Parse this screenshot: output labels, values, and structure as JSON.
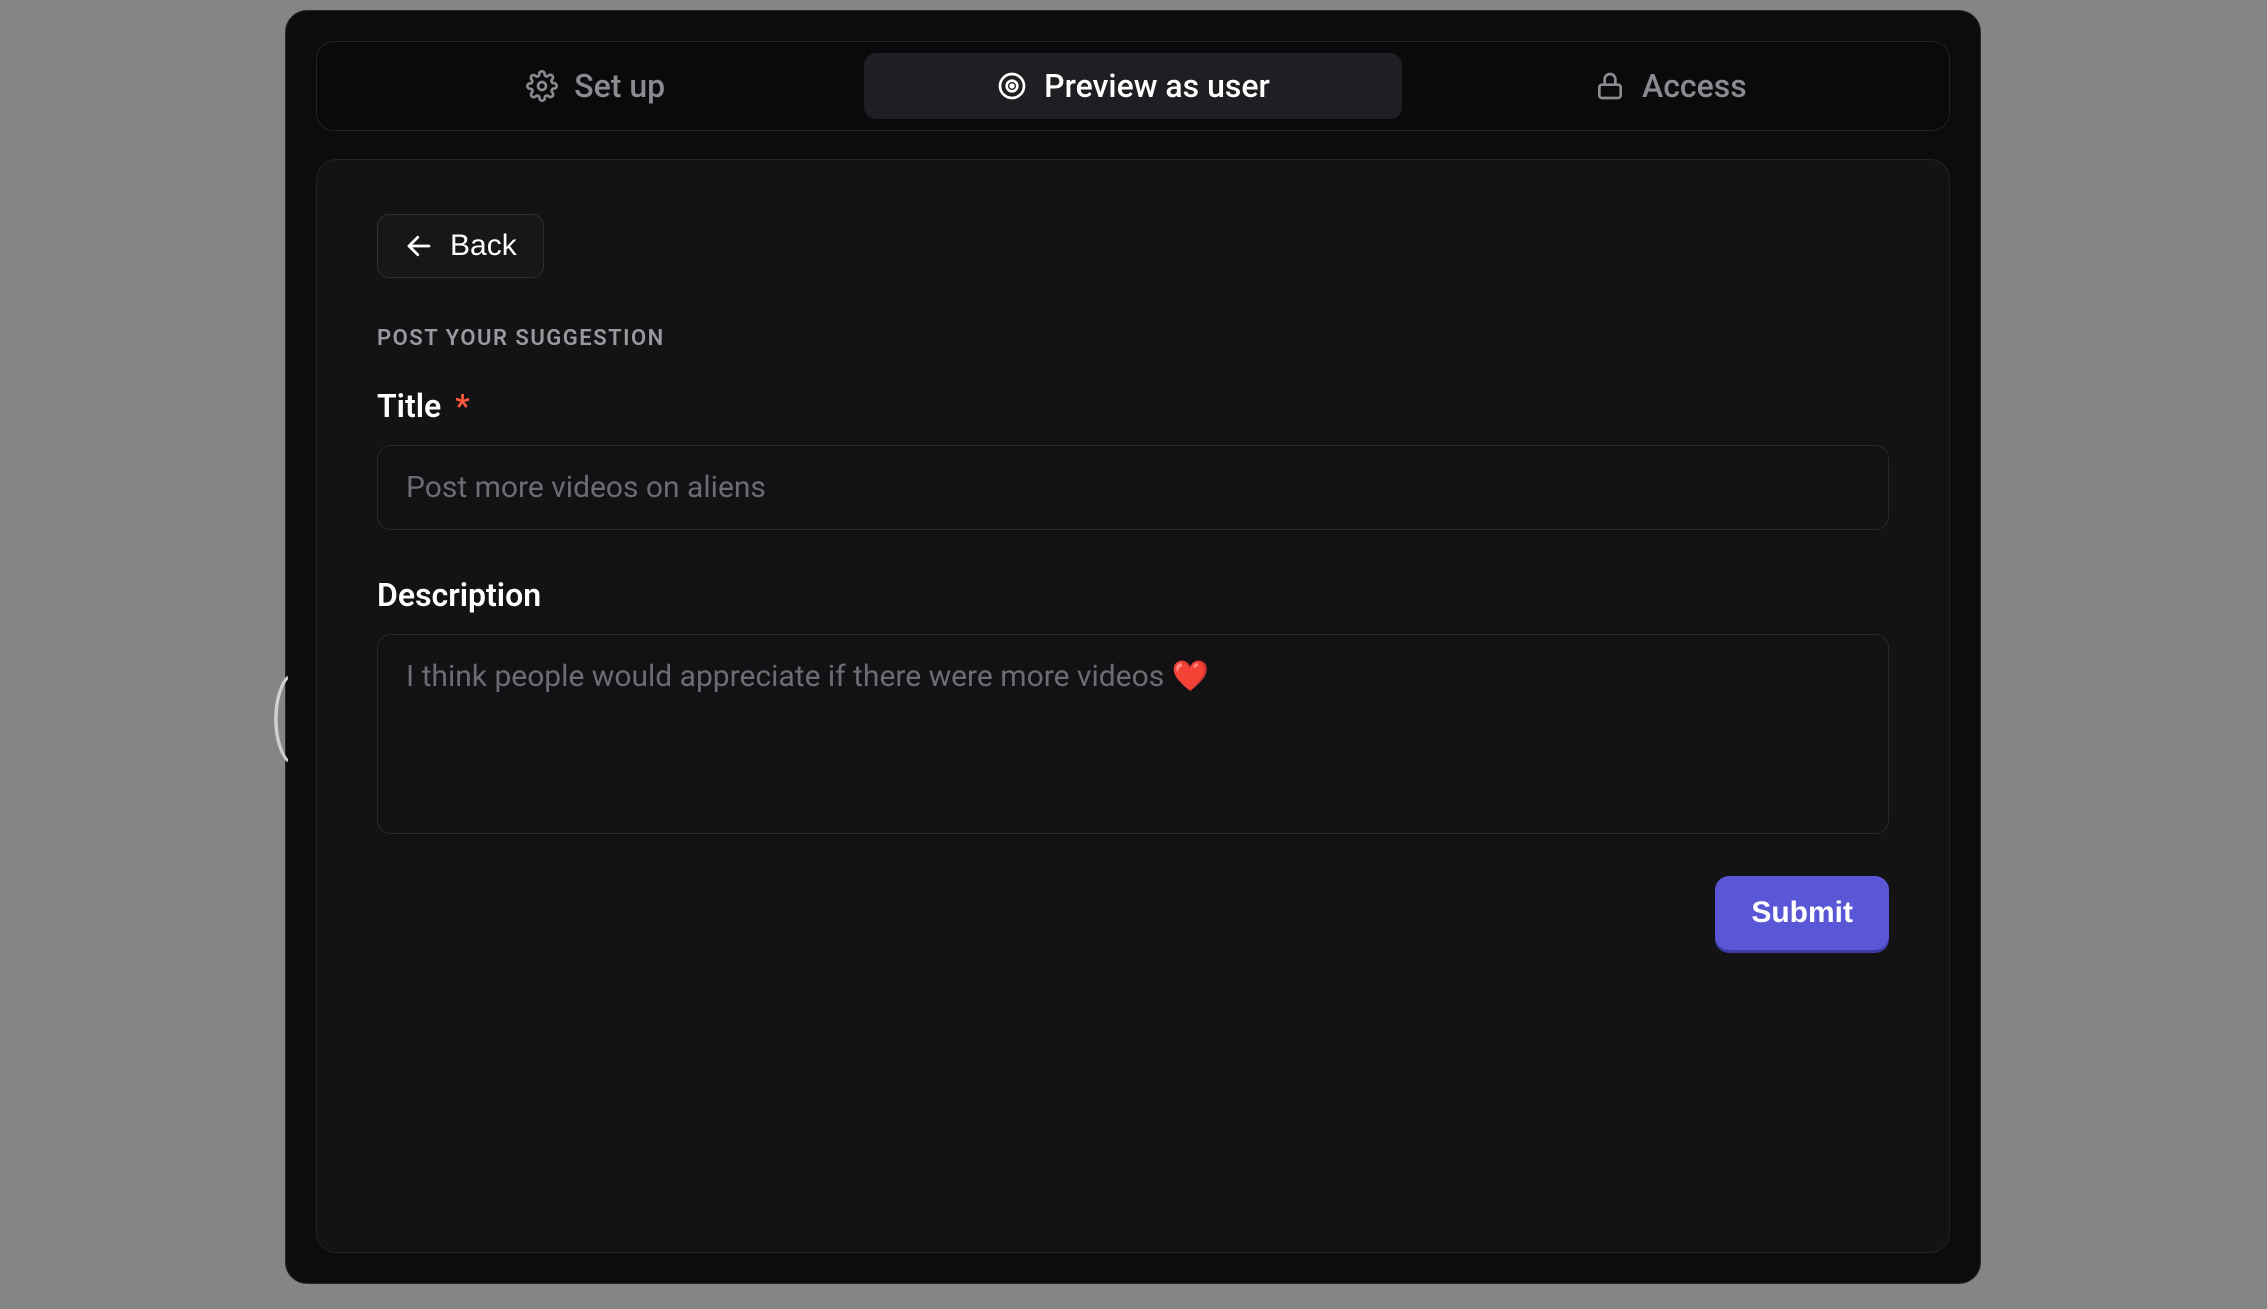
{
  "tabs": {
    "setup": {
      "label": "Set up"
    },
    "preview": {
      "label": "Preview as user"
    },
    "access": {
      "label": "Access"
    }
  },
  "back": {
    "label": "Back"
  },
  "form": {
    "heading": "POST YOUR SUGGESTION",
    "title_label": "Title",
    "title_required_marker": "*",
    "title_placeholder": "Post more videos on aliens",
    "title_value": "",
    "description_label": "Description",
    "description_placeholder": "I think people would appreciate if there were more videos ❤️",
    "description_value": "",
    "submit_label": "Submit"
  },
  "colors": {
    "accent": "#5a57d6",
    "required": "#ff5a3d"
  }
}
